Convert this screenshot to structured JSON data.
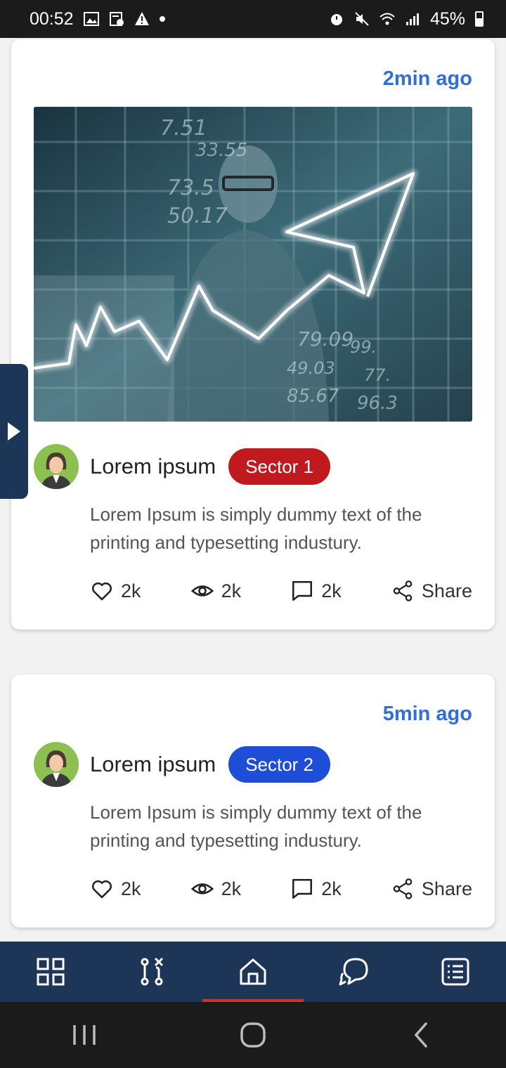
{
  "status_bar": {
    "time": "00:52",
    "battery": "45%",
    "icons": [
      "gallery-icon",
      "clipboard-check-icon",
      "warning-icon",
      "dot-icon",
      "alarm-icon",
      "mute-icon",
      "wifi-icon",
      "volte-icon",
      "signal-icon",
      "battery-icon"
    ]
  },
  "posts": [
    {
      "time_ago": "2min ago",
      "author": "Lorem ipsum",
      "sector": "Sector 1",
      "sector_color": "#c0191e",
      "text": "Lorem Ipsum is simply dummy text of the printing and typesetting industury.",
      "likes": "2k",
      "views": "2k",
      "comments": "2k",
      "share_label": "Share",
      "has_image": true,
      "image_numbers": [
        "7.51",
        "33.55",
        "73.5",
        "50.17",
        "79.09",
        "49.03",
        "99.",
        "77.",
        "96.3",
        "85.67"
      ]
    },
    {
      "time_ago": "5min ago",
      "author": "Lorem ipsum",
      "sector": "Sector 2",
      "sector_color": "#1e4ed8",
      "text": "Lorem Ipsum is simply dummy text of the printing and typesetting industury.",
      "likes": "2k",
      "views": "2k",
      "comments": "2k",
      "share_label": "Share",
      "has_image": false
    }
  ],
  "bottom_nav": {
    "items": [
      "dashboard-icon",
      "compare-icon",
      "home-icon",
      "chat-icon",
      "list-icon"
    ],
    "active": "home-icon",
    "active_color": "#d32f2f",
    "background": "#1d3557"
  },
  "system_nav": [
    "recents-icon",
    "home-button-icon",
    "back-icon"
  ]
}
